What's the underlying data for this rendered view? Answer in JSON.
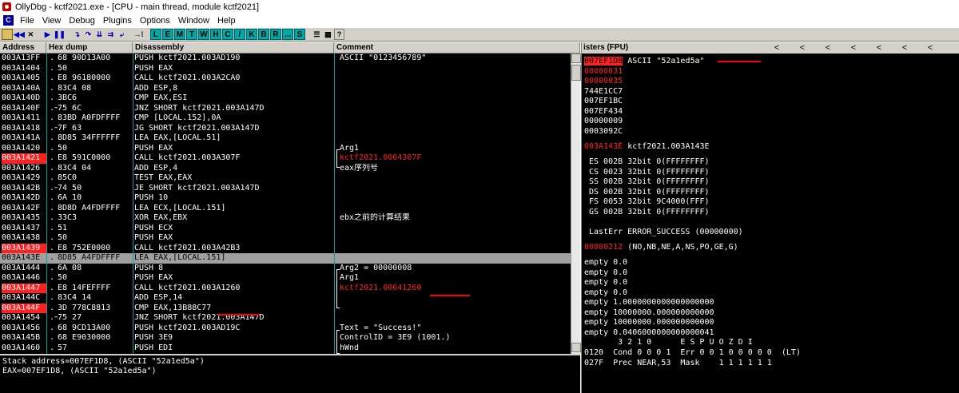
{
  "window": {
    "title": "OllyDbg - kctf2021.exe - [CPU - main thread, module kctf2021]"
  },
  "menu": [
    "File",
    "View",
    "Debug",
    "Plugins",
    "Options",
    "Window",
    "Help"
  ],
  "toolbar": {
    "letters": [
      "L",
      "E",
      "M",
      "T",
      "W",
      "H",
      "C",
      "/",
      "K",
      "B",
      "R",
      "...",
      "S"
    ],
    "icons": [
      "open-icon",
      "restart-icon",
      "close-icon",
      "run-icon",
      "pause-icon",
      "step-into-icon",
      "step-over-icon",
      "trace-into-icon",
      "trace-over-icon",
      "execute-till-return-icon",
      "goto-icon",
      "list-icon",
      "grid-icon",
      "help-icon"
    ]
  },
  "disasm": {
    "headers": {
      "address": "Address",
      "hex": "Hex dump",
      "disassembly": "Disassembly",
      "comment": "Comment"
    },
    "rows": [
      {
        "addr": "003A13FF",
        "mark": ".",
        "hex": "68 90D13A00",
        "dis": "PUSH kctf2021.003AD190",
        "com": "ASCII \"0123456789\""
      },
      {
        "addr": "003A1404",
        "mark": ".",
        "hex": "50",
        "dis": "PUSH EAX",
        "com": ""
      },
      {
        "addr": "003A1405",
        "mark": ".",
        "hex": "E8 96180000",
        "dis": "CALL kctf2021.003A2CA0",
        "com": ""
      },
      {
        "addr": "003A140A",
        "mark": ".",
        "hex": "83C4 08",
        "dis": "ADD ESP,8",
        "com": ""
      },
      {
        "addr": "003A140D",
        "mark": ".",
        "hex": "3BC6",
        "dis": "CMP EAX,ESI",
        "com": ""
      },
      {
        "addr": "003A140F",
        "mark": ".~",
        "hex": "75 6C",
        "dis": "JNZ SHORT kctf2021.003A147D",
        "com": ""
      },
      {
        "addr": "003A1411",
        "mark": ".",
        "hex": "83BD A0FDFFFF",
        "dis": "CMP [LOCAL.152],0A",
        "com": ""
      },
      {
        "addr": "003A1418",
        "mark": ".~",
        "hex": "7F 63",
        "dis": "JG SHORT kctf2021.003A147D",
        "com": ""
      },
      {
        "addr": "003A141A",
        "mark": ".",
        "hex": "8D85 34FFFFFF",
        "dis": "LEA EAX,[LOCAL.51]",
        "com": ""
      },
      {
        "addr": "003A1420",
        "mark": ".",
        "hex": "50",
        "dis": "PUSH EAX",
        "com": "Arg1"
      },
      {
        "addr": "003A1421",
        "mark": ".",
        "hex": "E8 591C0000",
        "dis": "CALL kctf2021.003A307F",
        "com": "kctf2021.0064307F"
      },
      {
        "addr": "003A1426",
        "mark": ".",
        "hex": "83C4 04",
        "dis": "ADD ESP,4",
        "com": "eax序列号"
      },
      {
        "addr": "003A1429",
        "mark": ".",
        "hex": "85C0",
        "dis": "TEST EAX,EAX",
        "com": ""
      },
      {
        "addr": "003A142B",
        "mark": ".~",
        "hex": "74 50",
        "dis": "JE SHORT kctf2021.003A147D",
        "com": ""
      },
      {
        "addr": "003A142D",
        "mark": ".",
        "hex": "6A 10",
        "dis": "PUSH 10",
        "com": ""
      },
      {
        "addr": "003A142F",
        "mark": ".",
        "hex": "8D8D A4FDFFFF",
        "dis": "LEA ECX,[LOCAL.151]",
        "com": ""
      },
      {
        "addr": "003A1435",
        "mark": ".",
        "hex": "33C3",
        "dis": "XOR EAX,EBX",
        "com": "ebx之前的计算结果"
      },
      {
        "addr": "003A1437",
        "mark": ".",
        "hex": "51",
        "dis": "PUSH ECX",
        "com": ""
      },
      {
        "addr": "003A1438",
        "mark": ".",
        "hex": "50",
        "dis": "PUSH EAX",
        "com": ""
      },
      {
        "addr": "003A1439",
        "mark": ".",
        "hex": "E8 752E0000",
        "dis": "CALL kctf2021.003A42B3",
        "com": ""
      },
      {
        "addr": "003A143E",
        "mark": ".",
        "hex": "8D85 A4FDFFFF",
        "dis": "LEA EAX,[LOCAL.151]",
        "com": ""
      },
      {
        "addr": "003A1444",
        "mark": ".",
        "hex": "6A 08",
        "dis": "PUSH 8",
        "com": "Arg2 = 00000008"
      },
      {
        "addr": "003A1446",
        "mark": ".",
        "hex": "50",
        "dis": "PUSH EAX",
        "com": "Arg1"
      },
      {
        "addr": "003A1447",
        "mark": ".",
        "hex": "E8 14FEFFFF",
        "dis": "CALL kctf2021.003A1260",
        "com": "kctf2021.00641260"
      },
      {
        "addr": "003A144C",
        "mark": ".",
        "hex": "83C4 14",
        "dis": "ADD ESP,14",
        "com": ""
      },
      {
        "addr": "003A144F",
        "mark": ".",
        "hex": "3D 778C8813",
        "dis": "CMP EAX,13B88C77",
        "com": ""
      },
      {
        "addr": "003A1454",
        "mark": ".~",
        "hex": "75 27",
        "dis": "JNZ SHORT kctf2021.003A147D",
        "com": ""
      },
      {
        "addr": "003A1456",
        "mark": ".",
        "hex": "68 9CD13A00",
        "dis": "PUSH kctf2021.003AD19C",
        "com": "Text = \"Success!\""
      },
      {
        "addr": "003A145B",
        "mark": ".",
        "hex": "68 E9030000",
        "dis": "PUSH 3E9",
        "com": "ControlID = 3E9 (1001.)"
      },
      {
        "addr": "003A1460",
        "mark": ".",
        "hex": "57",
        "dis": "PUSH EDI",
        "com": "hWnd"
      }
    ],
    "red_address_rows": [
      "003A1421",
      "003A1439",
      "003A1447",
      "003A144F"
    ],
    "selected_row": "003A143E",
    "red_comment_rows": [
      "003A1421",
      "003A1447"
    ]
  },
  "info": {
    "line1": "Stack address=007EF1D8, (ASCII \"52a1ed5a\")",
    "line2": "EAX=007EF1D8, (ASCII \"52a1ed5a\")"
  },
  "registers": {
    "header": "isters (FPU)",
    "arrows": [
      "<",
      "<",
      "<",
      "<",
      "<",
      "<",
      "<",
      "<"
    ],
    "eax_value": "007EF1D8",
    "eax_comment": "ASCII \"52a1ed5a\"",
    "ecx": "00000031",
    "edx": "00000035",
    "ebx": "744E1CC7",
    "esp": "007EF1BC",
    "ebp": "007EF434",
    "esi": "00000009",
    "edi": "0003092C",
    "eip_value": "003A143E",
    "eip_comment": "kctf2021.003A143E",
    "segments": [
      "ES 002B 32bit 0(FFFFFFFF)",
      "CS 0023 32bit 0(FFFFFFFF)",
      "SS 002B 32bit 0(FFFFFFFF)",
      "DS 002B 32bit 0(FFFFFFFF)",
      "FS 0053 32bit 9C4000(FFF)",
      "GS 002B 32bit 0(FFFFFFFF)"
    ],
    "lasterr": "LastErr ERROR_SUCCESS (00000000)",
    "efl_value": "00000212",
    "efl_flags": "(NO,NB,NE,A,NS,PO,GE,G)",
    "fpu": [
      "empty 0.0",
      "empty 0.0",
      "empty 0.0",
      "empty 0.0",
      "empty 1.0000000000000000000",
      "empty 10000000.000000000000",
      "empty 10000000.000000000000",
      "empty 0.0406000000000000041"
    ],
    "fpu_status_header": "       3 2 1 0      E S P U O Z D I",
    "fpu_status": "0120  Cond 0 0 0 1  Err 0 0 1 0 0 0 0 0  (LT)",
    "fpu_control": "027F  Prec NEAR,53  Mask    1 1 1 1 1 1"
  },
  "colors": {
    "background": "#000000",
    "text": "#ffffff",
    "highlight_red": "#ff2020",
    "selection": "#a0a0a0",
    "toolbar_letter": "#00a8a8"
  }
}
